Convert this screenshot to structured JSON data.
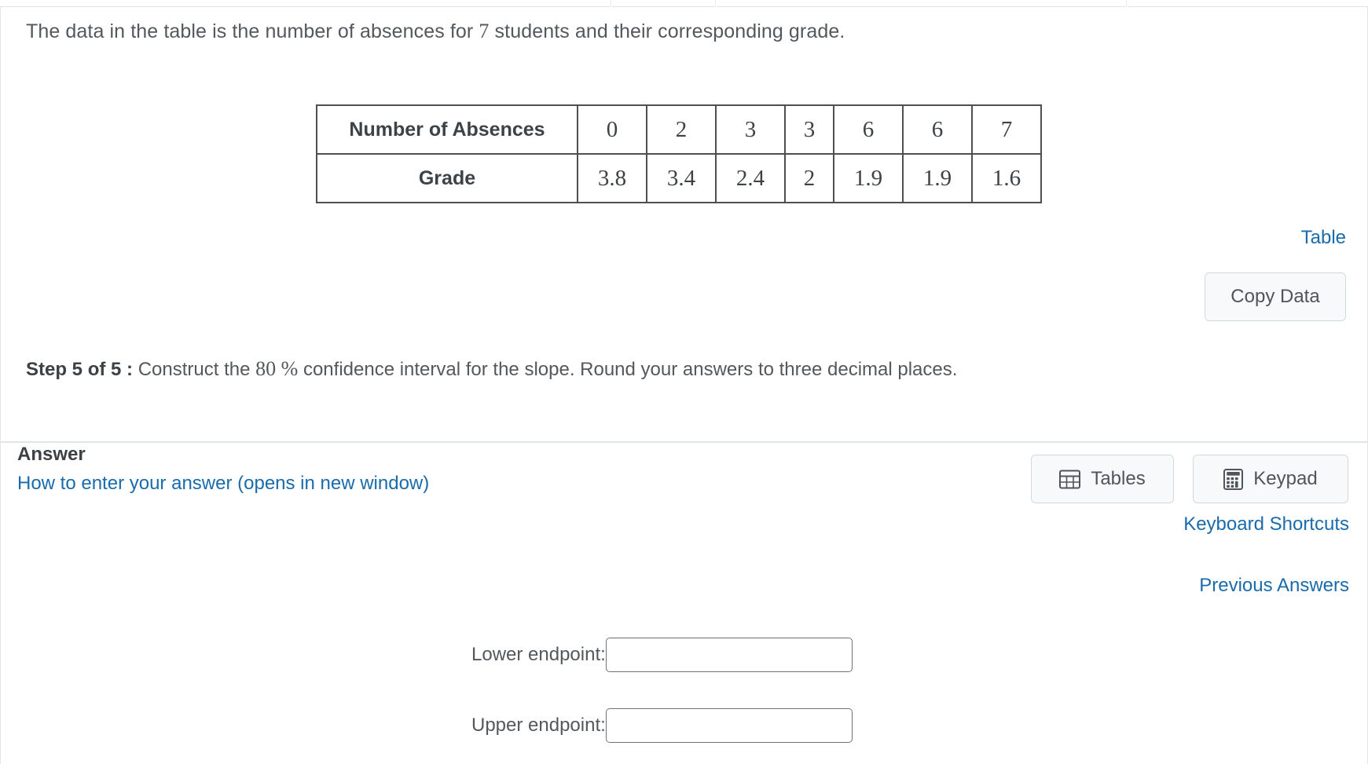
{
  "prompt": {
    "before": "The data in the table is the number of absences for ",
    "count": "7",
    "after": " students and their corresponding grade."
  },
  "table": {
    "row_headers": [
      "Number of Absences",
      "Grade"
    ],
    "absences": [
      "0",
      "2",
      "3",
      "3",
      "6",
      "6",
      "7"
    ],
    "grades": [
      "3.8",
      "3.4",
      "2.4",
      "2",
      "1.9",
      "1.9",
      "1.6"
    ]
  },
  "links": {
    "table": "Table",
    "how_to_enter": "How to enter your answer (opens in new window)",
    "keyboard_shortcuts": "Keyboard Shortcuts",
    "previous_answers": "Previous Answers",
    "color": "#1a6bac"
  },
  "buttons": {
    "copy_data": "Copy Data",
    "tables": "Tables",
    "keypad": "Keypad"
  },
  "step": {
    "label": "Step 5 of 5 :",
    "text_before": " Construct the ",
    "percent": "80 %",
    "text_after": " confidence interval for the slope. Round your answers to three decimal places."
  },
  "answer": {
    "heading": "Answer",
    "lower_label": "Lower endpoint:",
    "upper_label": "Upper endpoint:",
    "lower_value": "",
    "upper_value": "",
    "lower_placeholder": "",
    "upper_placeholder": ""
  },
  "chart_data": {
    "type": "table",
    "title": "Number of Absences vs Grade",
    "categories": [
      "Number of Absences",
      "Grade"
    ],
    "x": [
      0,
      2,
      3,
      3,
      6,
      6,
      7
    ],
    "series": [
      {
        "name": "Grade",
        "values": [
          3.8,
          3.4,
          2.4,
          2,
          1.9,
          1.9,
          1.6
        ]
      }
    ],
    "xlabel": "Number of Absences",
    "ylabel": "Grade",
    "n": 7
  }
}
